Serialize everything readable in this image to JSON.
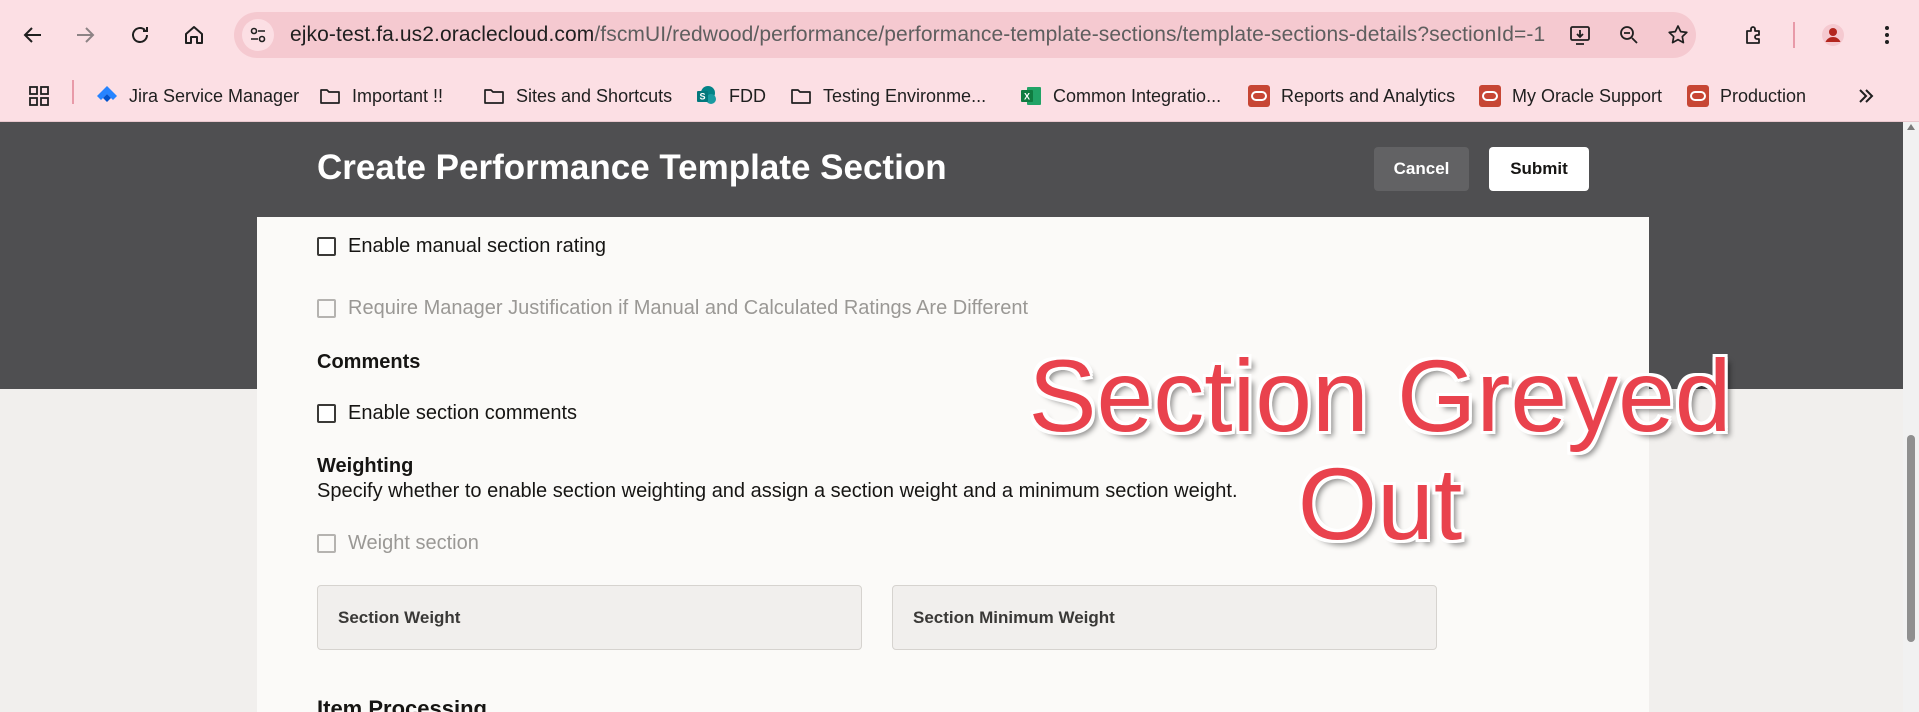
{
  "browser": {
    "url_host": "ejko-test.fa.us2.oraclecloud.com",
    "url_path": "/fscmUI/redwood/performance/performance-template-sections/template-sections-details?sectionId=-1",
    "bookmarks": [
      {
        "label": "Jira Service Manager",
        "icon": "jira-icon"
      },
      {
        "label": "Important !!",
        "icon": "folder-icon"
      },
      {
        "label": "Sites and Shortcuts",
        "icon": "folder-icon"
      },
      {
        "label": "FDD",
        "icon": "sharepoint-icon"
      },
      {
        "label": "Testing Environme...",
        "icon": "folder-icon"
      },
      {
        "label": "Common Integratio...",
        "icon": "excel-icon"
      },
      {
        "label": "Reports and Analytics",
        "icon": "oracle-icon"
      },
      {
        "label": "My Oracle Support",
        "icon": "oracle-icon"
      },
      {
        "label": "Production",
        "icon": "oracle-icon"
      }
    ],
    "colors": {
      "chrome": "#fcdfe4",
      "omnibox": "#f5c9d0",
      "oracle_red": "#c74634"
    }
  },
  "drawer": {
    "title": "Create Performance Template Section",
    "cancel_label": "Cancel",
    "submit_label": "Submit"
  },
  "form": {
    "enable_manual_rating": {
      "label": "Enable manual section rating",
      "checked": false
    },
    "require_justification": {
      "label": "Require Manager Justification if Manual and Calculated Ratings Are Different",
      "disabled": true
    },
    "comments_heading": "Comments",
    "enable_comments": {
      "label": "Enable section comments",
      "checked": false
    },
    "weighting_heading": "Weighting",
    "weighting_description": "Specify whether to enable section weighting and assign a section weight and a minimum section weight.",
    "weight_section": {
      "label": "Weight section",
      "disabled": true
    },
    "section_weight_label": "Section Weight",
    "section_min_weight_label": "Section Minimum Weight",
    "item_processing_heading": "Item Processing"
  },
  "annotation": {
    "line1": "Section Greyed",
    "line2": "Out",
    "color": "#e9424d"
  }
}
